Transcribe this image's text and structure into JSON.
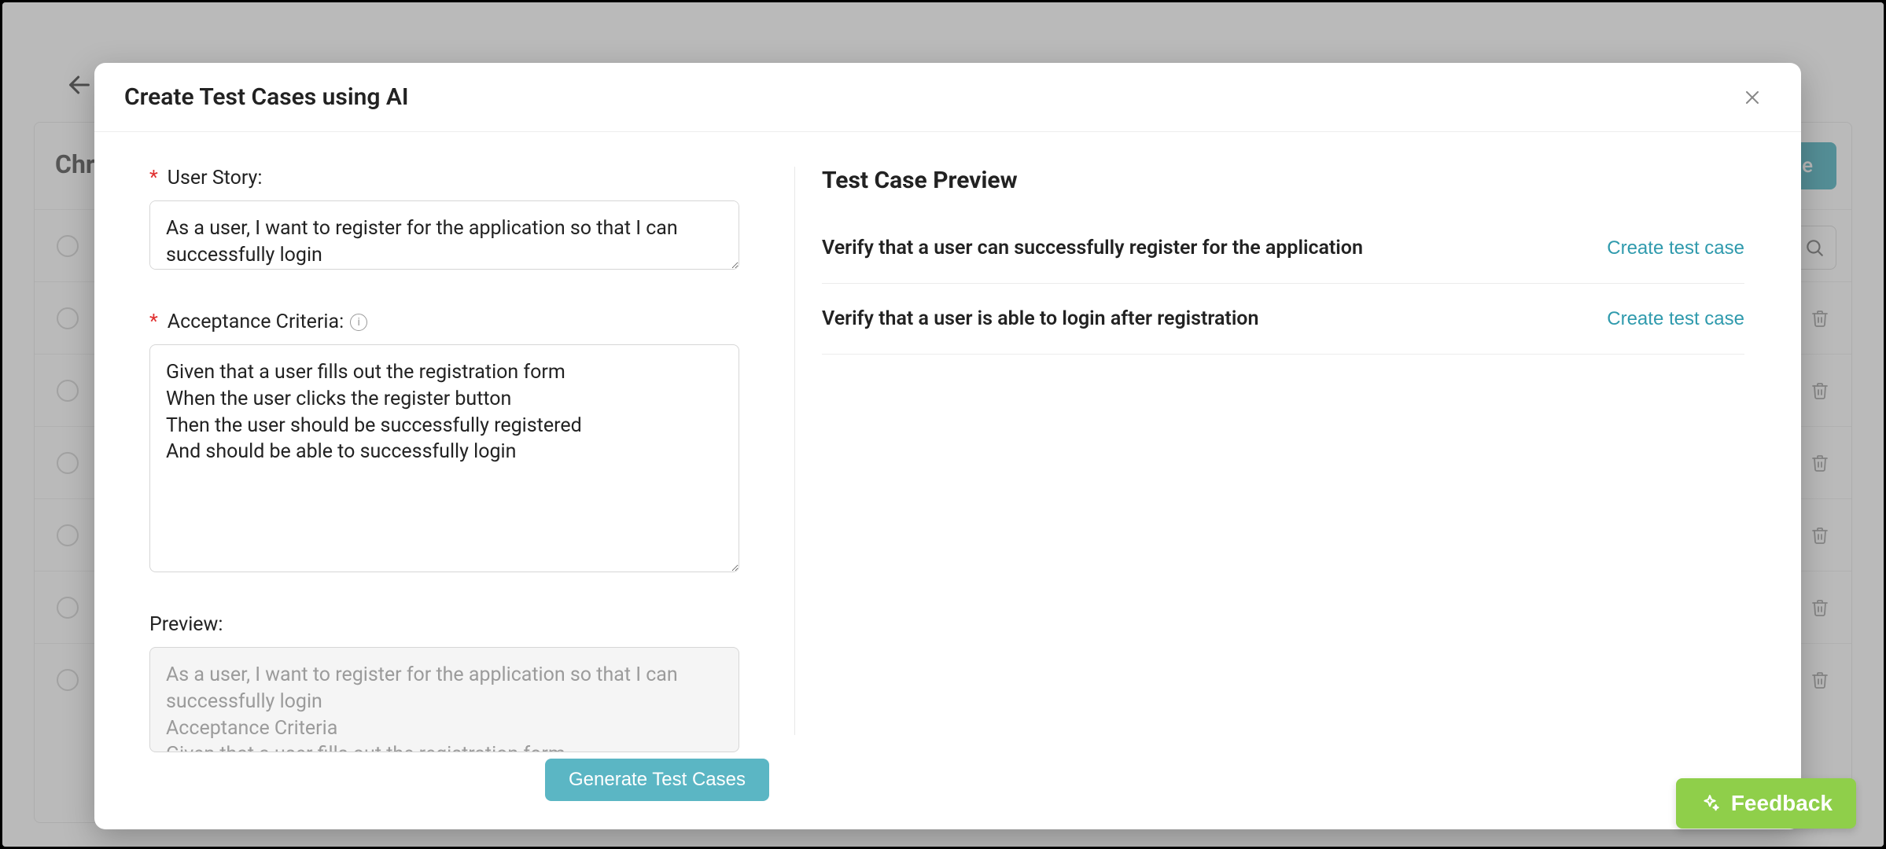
{
  "background": {
    "card_title_visible": "Chro",
    "create_button_tail": "se",
    "row_count": 7
  },
  "modal": {
    "title": "Create Test Cases using AI",
    "left": {
      "user_story_label": "User Story:",
      "user_story_value": "As a user, I want to register for the application so that I can successfully login",
      "acceptance_label": "Acceptance Criteria:",
      "acceptance_value": "Given that a user fills out the registration form\nWhen the user clicks the register button\nThen the user should be successfully registered\nAnd should be able to successfully login",
      "preview_label": "Preview:",
      "preview_text": "As a user, I want to register for the application so that I can successfully login\nAcceptance Criteria\nGiven that a user fills out the registration form",
      "generate_label": "Generate Test Cases"
    },
    "right": {
      "heading": "Test Case Preview",
      "items": [
        {
          "title": "Verify that a user can successfully register for the application",
          "action": "Create test case"
        },
        {
          "title": "Verify that a user is able to login after registration",
          "action": "Create test case"
        }
      ]
    }
  },
  "feedback_label": "Feedback"
}
